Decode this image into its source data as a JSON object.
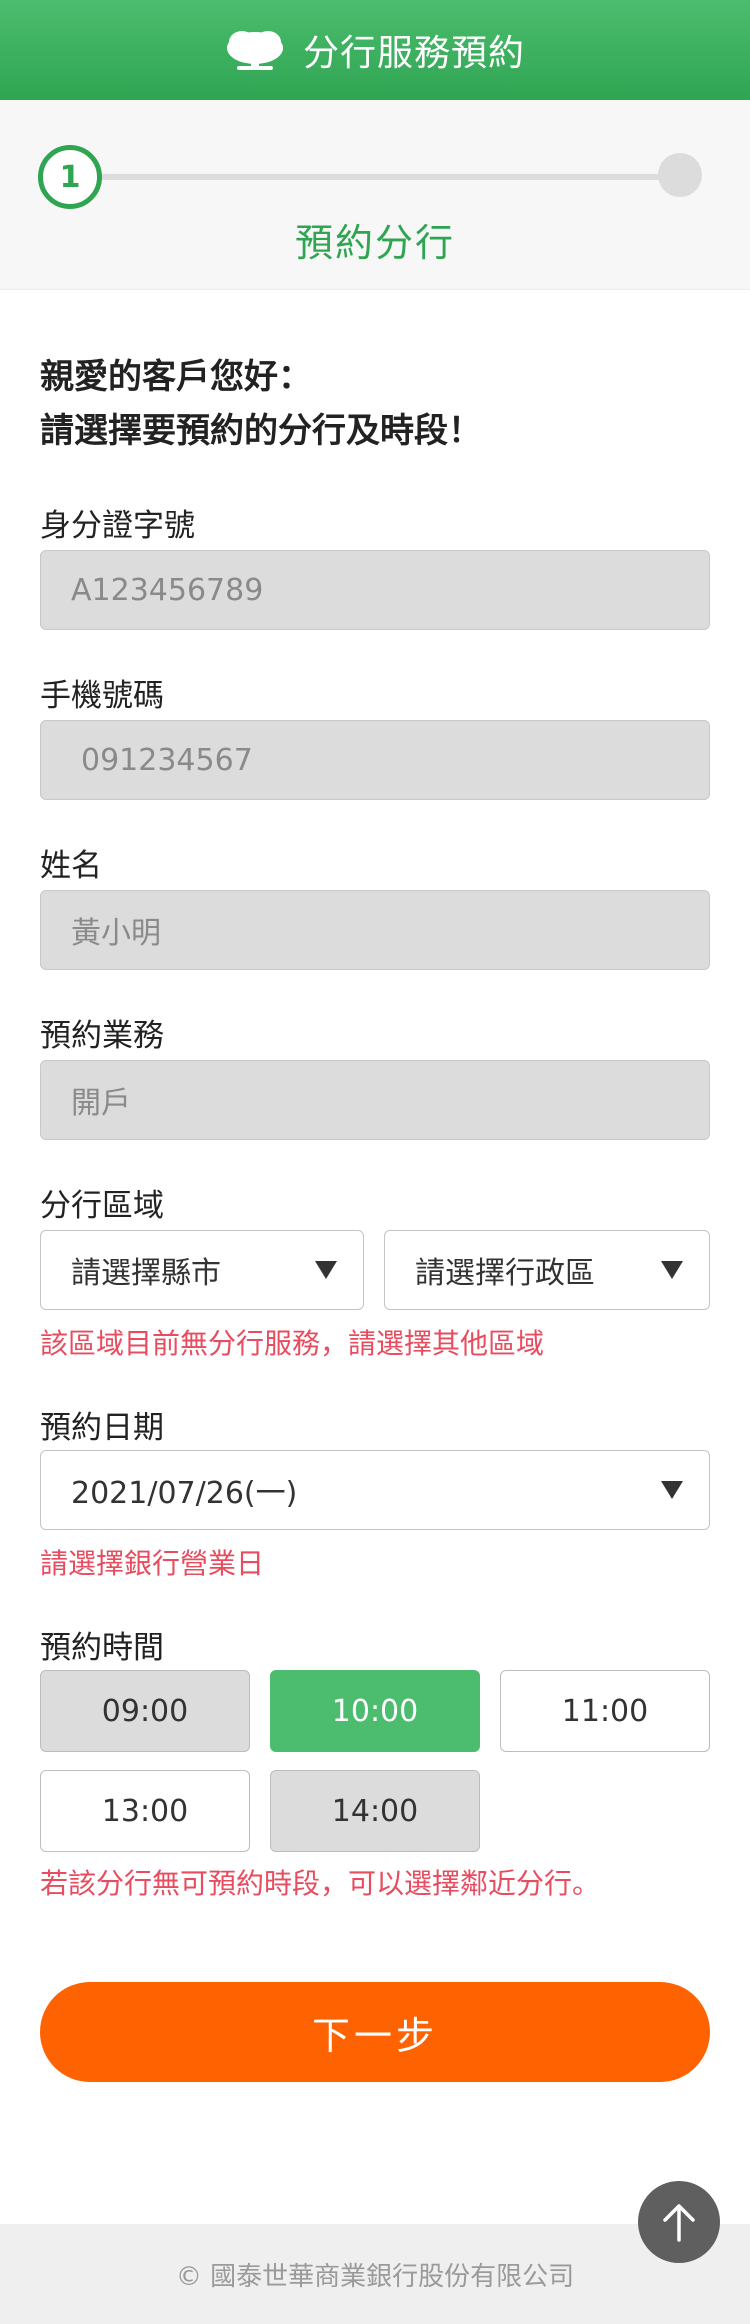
{
  "header": {
    "title": "分行服務預約",
    "logo_icon": "tree-logo-icon",
    "bg_color": "#2fa552"
  },
  "stepper": {
    "active_step": "1",
    "active_label": "預約分行",
    "accent_color": "#2fa552"
  },
  "greeting": {
    "line1": "親愛的客戶您好：",
    "line2": "請選擇要預約的分行及時段！"
  },
  "form": {
    "id_number": {
      "label": "身分證字號",
      "value": "A123456789"
    },
    "mobile": {
      "label": "手機號碼",
      "value": "091234567"
    },
    "name": {
      "label": "姓名",
      "value": "黃小明"
    },
    "service": {
      "label": "預約業務",
      "value": "開戶"
    },
    "branch_region": {
      "label": "分行區域",
      "city_selected": "請選擇縣市",
      "district_selected": "請選擇行政區",
      "error": "該區域目前無分行服務，請選擇其他區域"
    },
    "date": {
      "label": "預約日期",
      "selected": "2021/07/26(一)",
      "error": "請選擇銀行營業日"
    },
    "time": {
      "label": "預約時間",
      "slots": [
        {
          "label": "09:00",
          "state": "disabled"
        },
        {
          "label": "10:00",
          "state": "selected"
        },
        {
          "label": "11:00",
          "state": "available"
        },
        {
          "label": "13:00",
          "state": "available"
        },
        {
          "label": "14:00",
          "state": "disabled"
        }
      ],
      "error": "若該分行無可預約時段，可以選擇鄰近分行。"
    }
  },
  "actions": {
    "next_label": "下一步",
    "next_color": "#ff6200"
  },
  "footer": {
    "copyright": "© 國泰世華商業銀行股份有限公司"
  },
  "back_to_top_icon": "arrow-up-icon",
  "error_color": "#e84c5f"
}
